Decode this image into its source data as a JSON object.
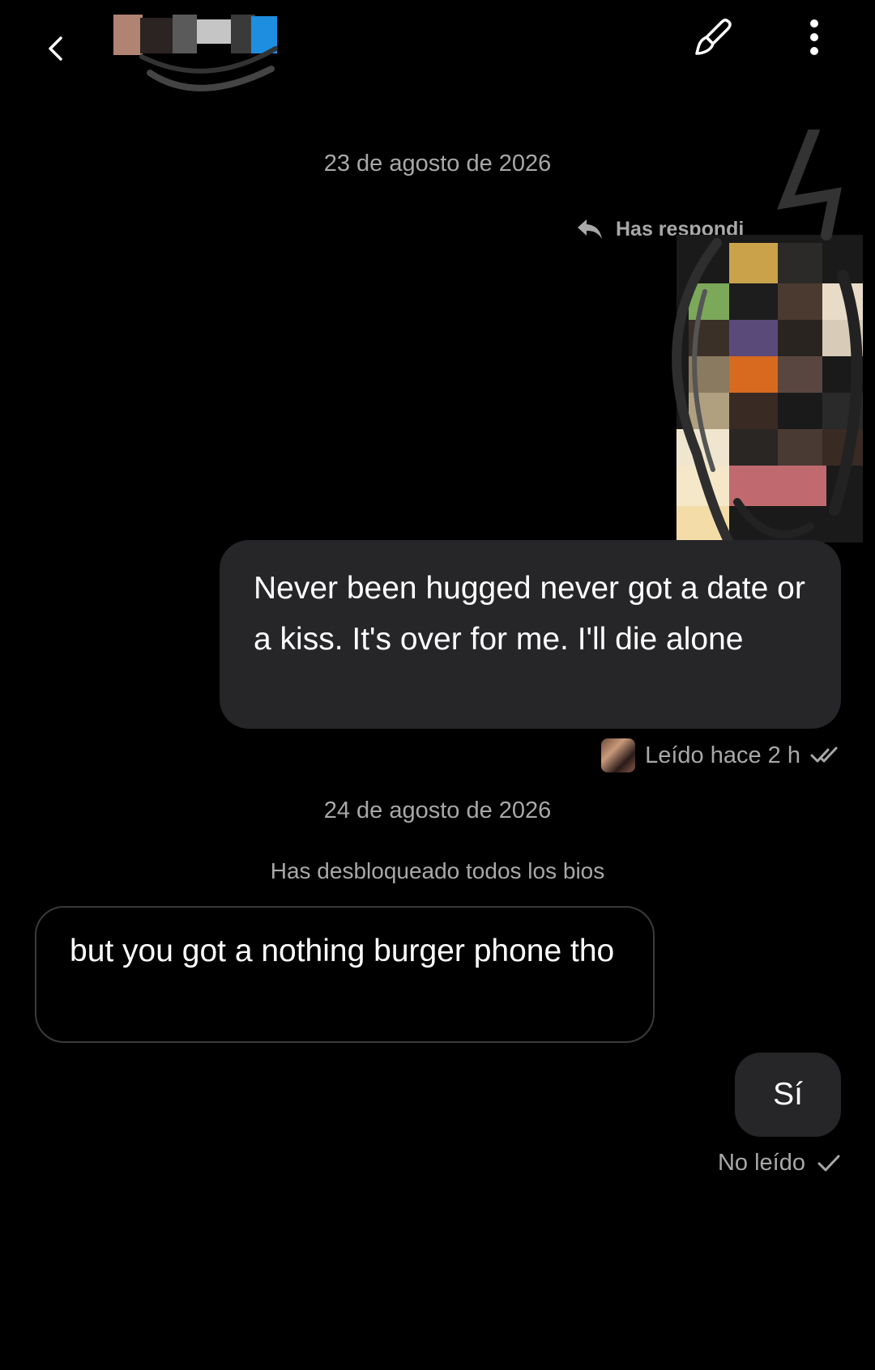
{
  "header": {
    "back_icon": "back-arrow-icon",
    "brush_icon": "paintbrush-icon",
    "more_icon": "more-vertical-icon"
  },
  "thread": {
    "date_1": "23 de agosto de 2026",
    "replied_label": "Has respondi",
    "message_out_1": "Never been hugged never got a date or a kiss. It's over for me. I'll die alone",
    "read_status": "Leído hace 2 h",
    "date_2": "24 de agosto de 2026",
    "system_message": "Has desbloqueado todos los bios",
    "message_in_1": "but you got a nothing burger phone tho",
    "message_out_2": "Sí",
    "unread_status": "No leído"
  },
  "colors": {
    "background": "#000000",
    "outgoing_bubble": "#262629",
    "meta_text": "#a8a8a8",
    "incoming_border": "#3a3a3d"
  }
}
